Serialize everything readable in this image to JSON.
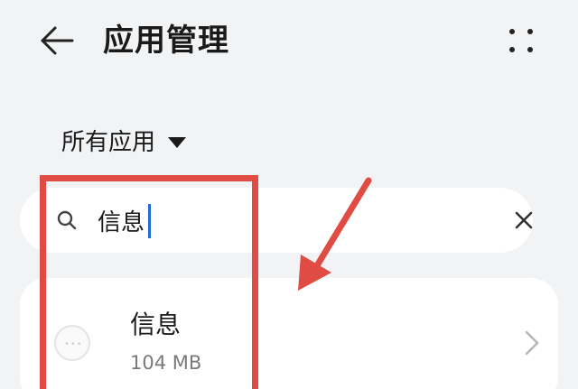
{
  "header": {
    "title": "应用管理",
    "back_icon": "arrow-left-icon",
    "more_icon": "more-dots-icon"
  },
  "filter": {
    "label": "所有应用",
    "caret_icon": "caret-down-icon"
  },
  "search": {
    "value": "信息",
    "search_icon": "search-icon",
    "clear_icon": "close-icon",
    "caret_color": "#1e6bd6"
  },
  "app_list": {
    "items": [
      {
        "name": "信息",
        "size": "104 MB",
        "icon": "messages-app-icon",
        "chevron_icon": "chevron-right-icon"
      }
    ]
  },
  "annotation": {
    "color": "#e04b43"
  },
  "colors": {
    "background": "#f1f3f5",
    "card": "#ffffff",
    "text_primary": "#1a1a1a",
    "text_secondary": "#7a7a7a"
  }
}
